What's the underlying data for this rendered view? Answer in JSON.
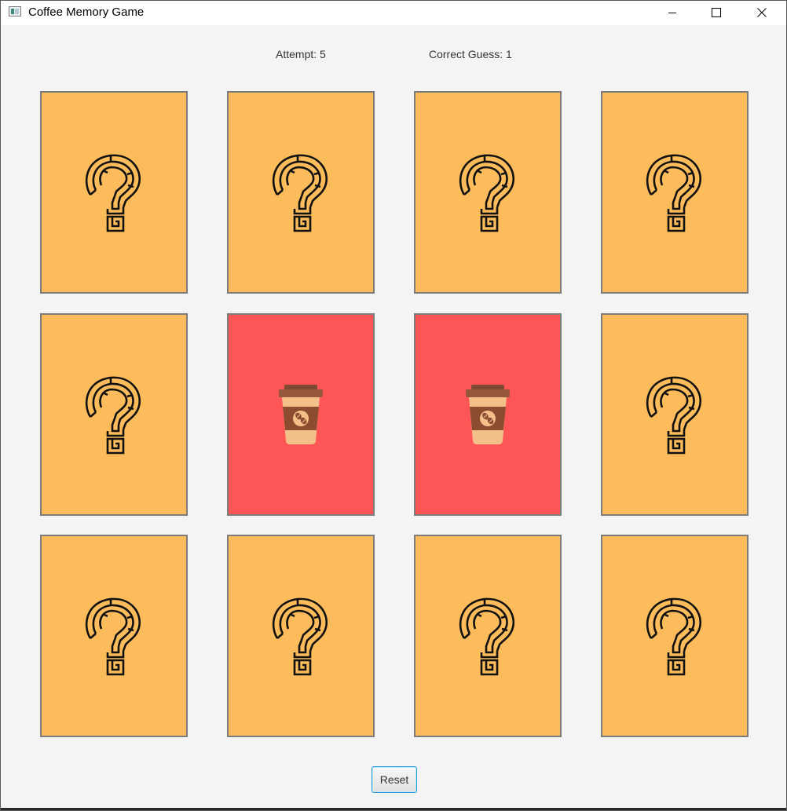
{
  "window": {
    "title": "Coffee Memory Game"
  },
  "stats": {
    "attempt": "Attempt: 5",
    "correct": "Correct Guess: 1"
  },
  "colors": {
    "card_back": "#fdbc5b",
    "card_matched": "#fe5656",
    "card_border": "#7c7c7c"
  },
  "cards": [
    {
      "state": "hidden",
      "icon": "question-mark-maze-icon"
    },
    {
      "state": "hidden",
      "icon": "question-mark-maze-icon"
    },
    {
      "state": "hidden",
      "icon": "question-mark-maze-icon"
    },
    {
      "state": "hidden",
      "icon": "question-mark-maze-icon"
    },
    {
      "state": "hidden",
      "icon": "question-mark-maze-icon"
    },
    {
      "state": "revealed",
      "icon": "coffee-cup-icon"
    },
    {
      "state": "revealed",
      "icon": "coffee-cup-icon"
    },
    {
      "state": "hidden",
      "icon": "question-mark-maze-icon"
    },
    {
      "state": "hidden",
      "icon": "question-mark-maze-icon"
    },
    {
      "state": "hidden",
      "icon": "question-mark-maze-icon"
    },
    {
      "state": "hidden",
      "icon": "question-mark-maze-icon"
    },
    {
      "state": "hidden",
      "icon": "question-mark-maze-icon"
    }
  ],
  "reset_label": "Reset"
}
